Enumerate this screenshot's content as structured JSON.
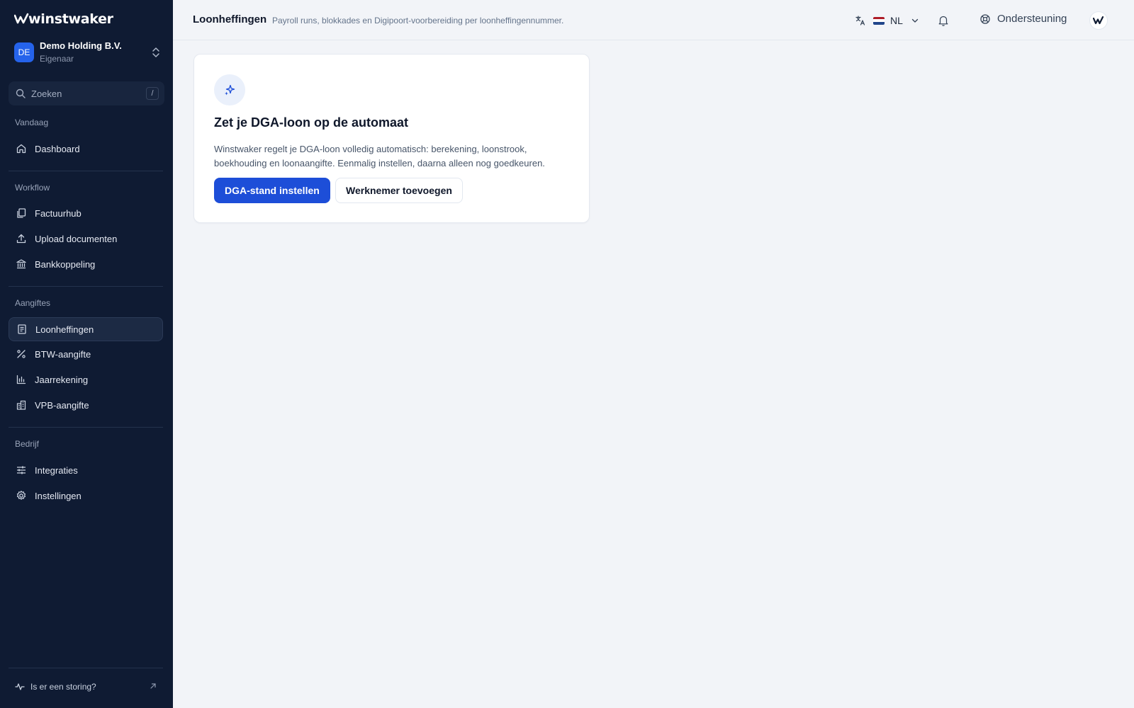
{
  "app": {
    "logo_text": "winstwaker",
    "logo_icon": "winstwaker-mark-icon"
  },
  "org": {
    "avatar_initials": "DE",
    "name": "Demo Holding B.V.",
    "role": "Eigenaar"
  },
  "search": {
    "placeholder": "Zoeken",
    "shortcut": "/"
  },
  "sidebar": {
    "sections": [
      {
        "label": "Vandaag",
        "items": [
          {
            "label": "Dashboard",
            "icon": "home-icon"
          }
        ]
      },
      {
        "label": "Workflow",
        "items": [
          {
            "label": "Factuurhub",
            "icon": "documents-icon"
          },
          {
            "label": "Upload documenten",
            "icon": "upload-icon"
          },
          {
            "label": "Bankkoppeling",
            "icon": "bank-icon"
          }
        ]
      },
      {
        "label": "Aangiftes",
        "items": [
          {
            "label": "Loonheffingen",
            "icon": "receipt-icon",
            "active": true
          },
          {
            "label": "BTW-aangifte",
            "icon": "percent-icon"
          },
          {
            "label": "Jaarrekening",
            "icon": "bar-chart-icon"
          },
          {
            "label": "VPB-aangifte",
            "icon": "building-icon"
          }
        ]
      },
      {
        "label": "Bedrijf",
        "items": [
          {
            "label": "Integraties",
            "icon": "sliders-icon"
          },
          {
            "label": "Instellingen",
            "icon": "gear-icon"
          }
        ]
      }
    ],
    "status_link": "Is er een storing?"
  },
  "header": {
    "title": "Loonheffingen",
    "subtitle": "Payroll runs, blokkades en Digipoort-voorbereiding per loonheffingennummer.",
    "language": "NL",
    "support_label": "Ondersteuning"
  },
  "card": {
    "icon": "sparkles-icon",
    "title": "Zet je DGA-loon op de automaat",
    "body": "Winstwaker regelt je DGA-loon volledig automatisch: berekening, loonstrook, boekhouding en loonaangifte. Eenmalig instellen, daarna alleen nog goedkeuren.",
    "primary_button": "DGA-stand instellen",
    "secondary_button": "Werknemer toevoegen"
  },
  "colors": {
    "sidebar_bg": "#0f1b33",
    "accent": "#1d4ed8",
    "page_bg": "#f2f4f8"
  }
}
